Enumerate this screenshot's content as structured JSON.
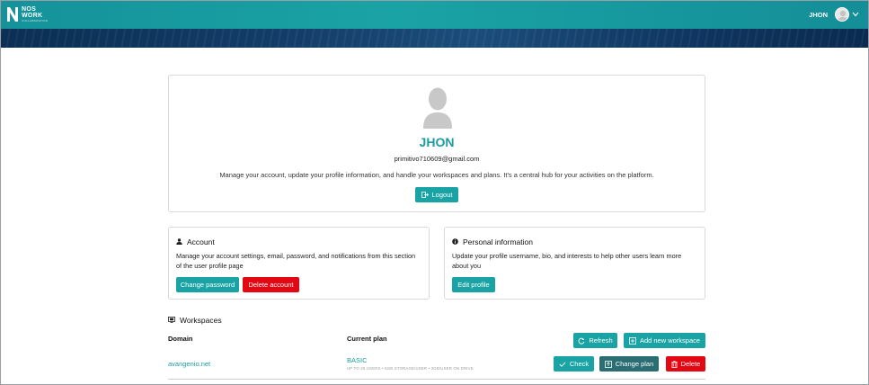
{
  "header": {
    "logo_line1": "NOS",
    "logo_line2": "WORK",
    "logo_tagline": "COLLABORATION",
    "user_name": "JHON"
  },
  "profile": {
    "name": "JHON",
    "email": "primitivo710609@gmail.com",
    "description": "Manage your account, update your profile information, and handle your workspaces and plans. It's a central hub for your activities on the platform.",
    "logout_label": "Logout"
  },
  "account": {
    "title": "Account",
    "text": "Manage your account settings, email, password, and notifications from this section of the user profile page",
    "change_password_label": "Change password",
    "delete_account_label": "Delete account"
  },
  "personal": {
    "title": "Personal information",
    "text": "Update your profile username, bio, and interests to help other users learn more about you",
    "edit_profile_label": "Edit profile"
  },
  "workspaces": {
    "title": "Workspaces",
    "col_domain": "Domain",
    "col_plan": "Current plan",
    "refresh_label": "Refresh",
    "add_label": "Add new workspace",
    "rows": [
      {
        "domain": "avangenio.net",
        "plan": "BASIC",
        "plan_details": "UP TO 25 USERS • 6GB STORAGE/USER • 3GB/USER ON DRIVE",
        "check_label": "Check",
        "change_plan_label": "Change plan",
        "delete_label": "Delete"
      }
    ]
  },
  "colors": {
    "accent": "#1aa3a4",
    "danger": "#e30613",
    "dark_teal": "#2a6d72",
    "banner": "#123b66"
  }
}
